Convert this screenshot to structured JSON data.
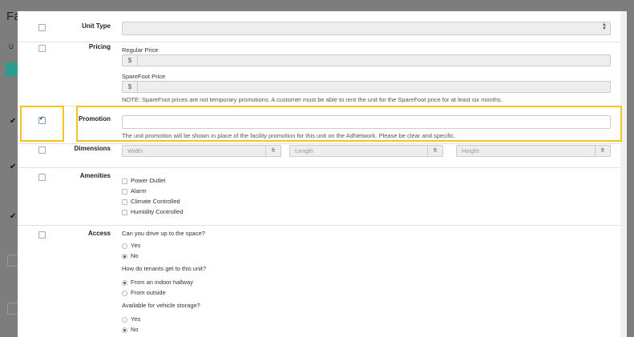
{
  "background": {
    "title": "Fa",
    "first_col": "U"
  },
  "form": {
    "unit_type": {
      "label": "Unit Type"
    },
    "pricing": {
      "label": "Pricing",
      "regular_label": "Regular Price",
      "spare_label": "SpareFoot Price",
      "currency": "$",
      "note": "NOTE: SpareFoot prices are not temporary promotions. A customer must be able to rent the unit for the SpareFoot price for at least six months."
    },
    "promotion": {
      "label": "Promotion",
      "value": "",
      "help": "The unit promotion will be shown in place of the facility promotion for this unit on the AdNetwork. Please be clear and specific.",
      "checked": true
    },
    "dimensions": {
      "label": "Dimensions",
      "unit": "ft",
      "width_placeholder": "Width",
      "length_placeholder": "Length",
      "height_placeholder": "Height"
    },
    "amenities": {
      "label": "Amenities",
      "items": [
        "Power Outlet",
        "Alarm",
        "Climate Controlled",
        "Humidity Controlled"
      ]
    },
    "access": {
      "label": "Access",
      "q1": "Can you drive up to the space?",
      "q1_options": [
        "Yes",
        "No"
      ],
      "q1_selected": "No",
      "q2": "How do tenants get to this unit?",
      "q2_options": [
        "From an indoor hallway",
        "From outside"
      ],
      "q2_selected": "From an indoor hallway",
      "q3": "Available for vehicle storage?",
      "q3_options": [
        "Yes",
        "No"
      ],
      "q3_selected": "No"
    }
  },
  "colors": {
    "highlight": "#f5c518",
    "overlay": "#7d7d7d"
  }
}
